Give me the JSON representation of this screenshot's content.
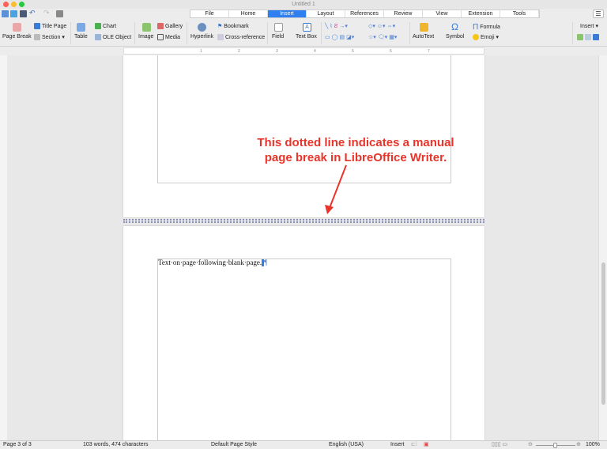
{
  "window": {
    "title": "Untitled 1"
  },
  "tabs": [
    "File",
    "Home",
    "Insert",
    "Layout",
    "References",
    "Review",
    "View",
    "Extension",
    "Tools"
  ],
  "active_tab": "Insert",
  "ribbon": {
    "page_break": "Page Break",
    "title_page": "Title Page",
    "section": "Section",
    "table": "Table",
    "chart": "Chart",
    "ole_object": "OLE Object",
    "image": "Image",
    "gallery": "Gallery",
    "media": "Media",
    "hyperlink": "Hyperlink",
    "bookmark": "Bookmark",
    "cross_reference": "Cross-reference",
    "field": "Field",
    "text_box": "Text Box",
    "autotext": "AutoText",
    "symbol": "Symbol",
    "formula": "Formula",
    "emoji": "Emoji",
    "insert_dropdown": "Insert"
  },
  "ruler": {
    "ticks": [
      "1",
      "2",
      "3",
      "4",
      "5",
      "6",
      "7"
    ]
  },
  "document": {
    "page2_text": "Text·on·page·following·blank·page.",
    "pilcrow": "¶"
  },
  "annotation": {
    "line1": "This dotted line indicates a manual",
    "line2": "page break in LibreOffice Writer."
  },
  "status": {
    "page": "Page 3 of 3",
    "words": "103 words, 474 characters",
    "page_style": "Default Page Style",
    "language": "English (USA)",
    "mode": "Insert",
    "zoom": "100%"
  },
  "colors": {
    "accent": "#2f7ff1",
    "annotation": "#e8342a"
  }
}
